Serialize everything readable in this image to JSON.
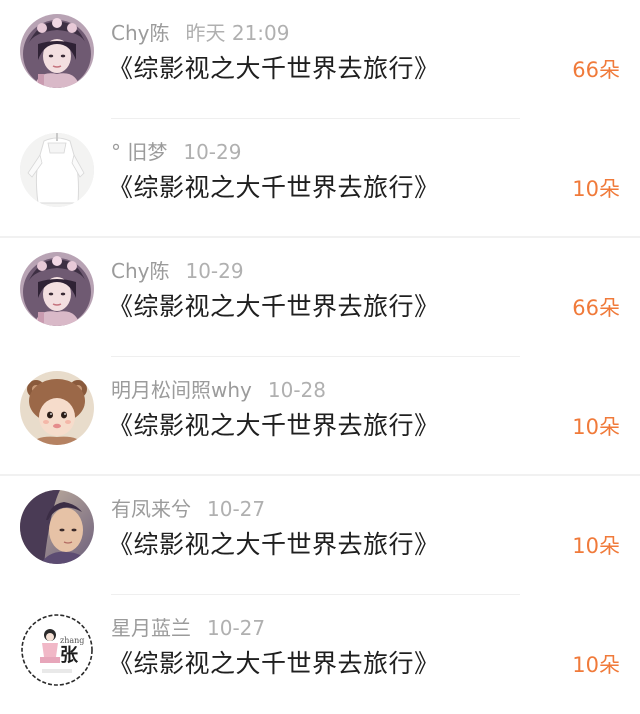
{
  "rows": [
    {
      "name": "Chy陈",
      "time": "昨天 21:09",
      "title": "《综影视之大千世界去旅行》",
      "count": "66朵",
      "avatar": "avatar-ancient-woman"
    },
    {
      "name": "°  旧梦",
      "time": "10-29",
      "title": "《综影视之大千世界去旅行》",
      "count": "10朵",
      "avatar": "avatar-white-dress"
    },
    {
      "name": "Chy陈",
      "time": "10-29",
      "title": "《综影视之大千世界去旅行》",
      "count": "66朵",
      "avatar": "avatar-ancient-woman"
    },
    {
      "name": "明月松间照why",
      "time": "10-28",
      "title": "《综影视之大千世界去旅行》",
      "count": "10朵",
      "avatar": "avatar-baby-bear-hat"
    },
    {
      "name": "有凤来兮",
      "time": "10-27",
      "title": "《综影视之大千世界去旅行》",
      "count": "10朵",
      "avatar": "avatar-anime-man"
    },
    {
      "name": "星月蓝兰",
      "time": "10-27",
      "title": "《综影视之大千世界去旅行》",
      "count": "10朵",
      "avatar": "avatar-zhang-badge"
    }
  ],
  "avatar_badge": {
    "latin": "zhang",
    "hanzi": "张"
  },
  "colors": {
    "count": "#f07a3a",
    "meta": "#a3a3a3",
    "title": "#1f1f1f"
  }
}
